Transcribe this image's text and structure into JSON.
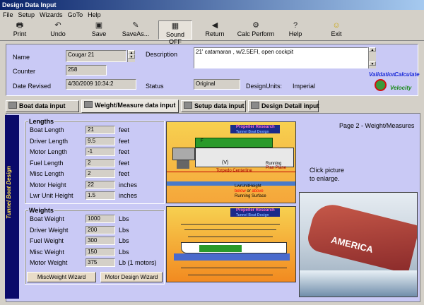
{
  "window": {
    "title": "Design Data Input"
  },
  "menu": [
    "File",
    "Setup",
    "Wizards",
    "GoTo",
    "Help"
  ],
  "toolbar": {
    "print": "Print",
    "undo": "Undo",
    "save": "Save",
    "save_as": "SaveAs...",
    "sound_off": "Sound OFF",
    "return": "Return",
    "calc_perform": "Calc Perform",
    "help": "Help",
    "exit": "Exit"
  },
  "header": {
    "name_label": "Name",
    "name_value": "Cougar 21",
    "counter_label": "Counter",
    "counter_value": "258",
    "date_label": "Date Revised",
    "date_value": "4/30/2009 10:34:2",
    "description_label": "Description",
    "description_value": "21' catamaran , w/2.5EFI, open cockpit",
    "status_label": "Status",
    "status_value": "Original",
    "design_units_label": "DesignUnits:",
    "design_units_value": "Imperial",
    "validation_logo": "Validation",
    "calculate_logo": "Calculate",
    "velocity_logo": "Velocity"
  },
  "tabs": [
    "Boat data input",
    "Weight/Measure data input",
    "Setup data input",
    "Design Detail input"
  ],
  "sidebar_text": "Tunnel Boat Design",
  "page_label": "Page 2 - Weight/Measures",
  "lengths": {
    "title": "Lengths",
    "rows": [
      {
        "label": "Boat Length",
        "value": "21",
        "unit": "feet"
      },
      {
        "label": "Driver Length",
        "value": "9.5",
        "unit": "feet"
      },
      {
        "label": "Motor Length",
        "value": "-1",
        "unit": "feet"
      },
      {
        "label": "Fuel Length",
        "value": "2",
        "unit": "feet"
      },
      {
        "label": "Misc Length",
        "value": "2",
        "unit": "feet"
      },
      {
        "label": "Motor Height",
        "value": "22",
        "unit": "inches"
      },
      {
        "label": "Lwr Unit Height",
        "value": "1.5",
        "unit": "inches"
      }
    ]
  },
  "weights": {
    "title": "Weights",
    "rows": [
      {
        "label": "Boat Weight",
        "value": "1000",
        "unit": "Lbs"
      },
      {
        "label": "Driver Weight",
        "value": "200",
        "unit": "Lbs"
      },
      {
        "label": "Fuel Weight",
        "value": "300",
        "unit": "Lbs"
      },
      {
        "label": "Misc Weight",
        "value": "150",
        "unit": "Lbs"
      },
      {
        "label": "Motor Weight",
        "value": "375",
        "unit": "Lb (1 motors)"
      }
    ],
    "misc_wizard": "MiscWeight Wizard",
    "motor_wizard": "Motor Design Wizard"
  },
  "diagram_top": {
    "brand": "Propeller Research",
    "sub": "Tunnel Boat Design",
    "running": "Running",
    "plane": "Plan Plane",
    "torpedo": "Torpedo Centerline",
    "lwr": "LwrUnitHeight",
    "lwr_sub1": "below",
    "lwr_or": "or",
    "lwr_sub2": "above",
    "surface": "Running Surface",
    "f_mark": "F",
    "v_mark": "(V)"
  },
  "diagram_bottom": {
    "brand": "Propeller Research",
    "sub": "Tunnel Boat Design"
  },
  "click_note": "Click picture to enlarge.",
  "photo": {
    "hull_text": "AMERICA"
  }
}
